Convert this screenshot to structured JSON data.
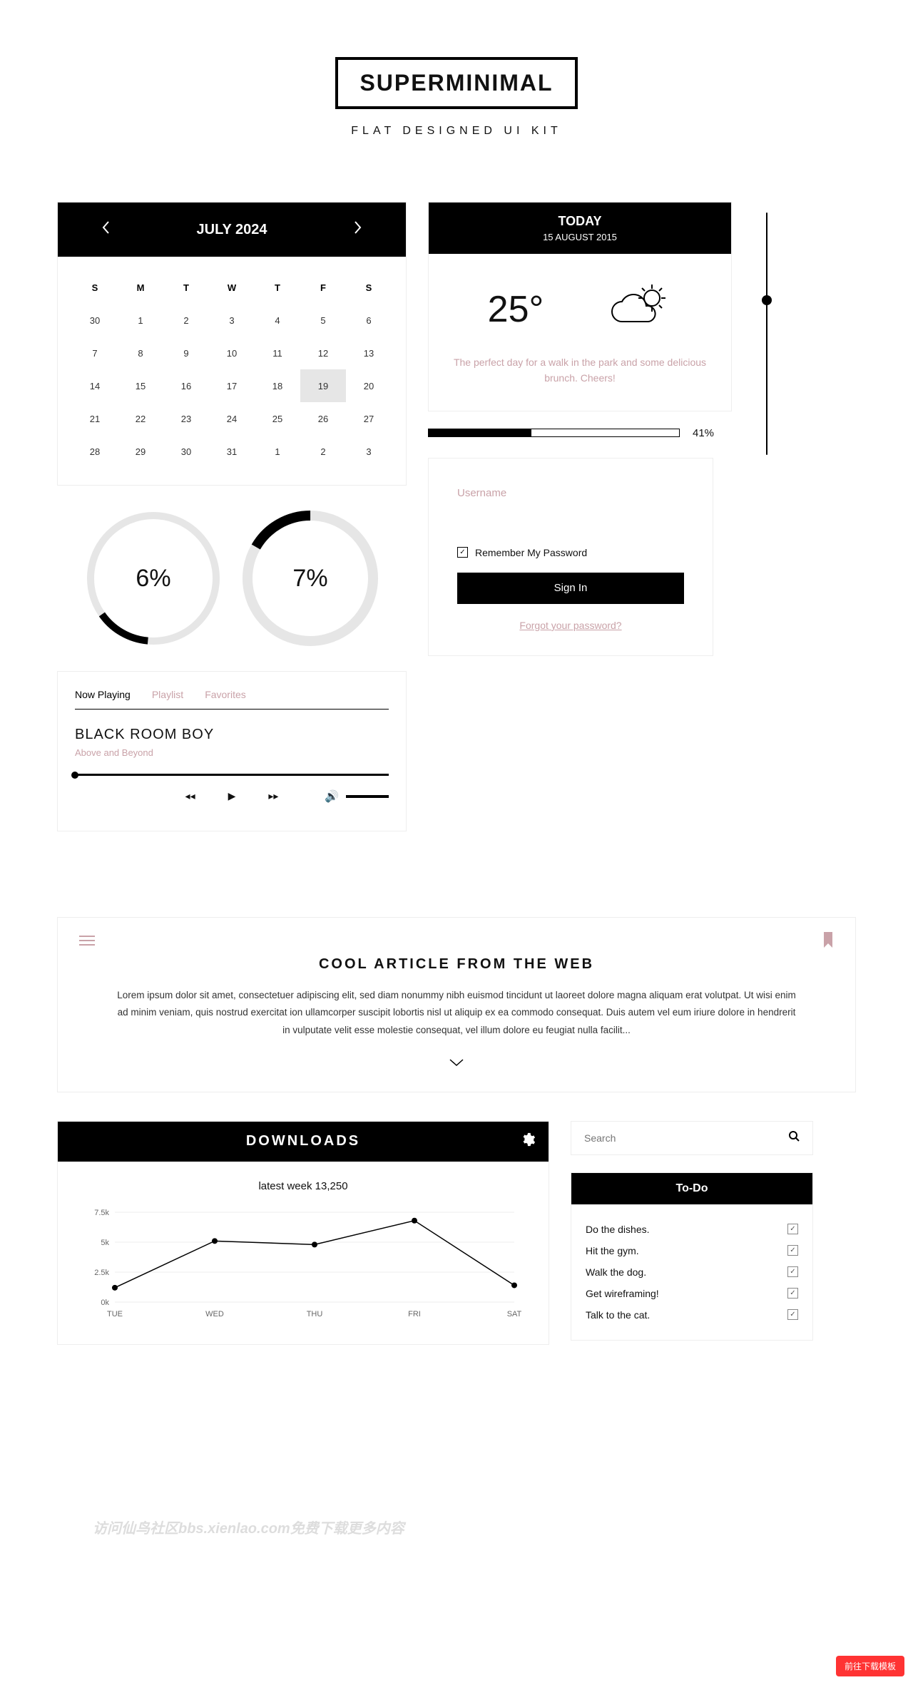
{
  "header": {
    "title": "SUPERMINIMAL",
    "subtitle": "FLAT DESIGNED UI KIT"
  },
  "calendar": {
    "month_label": "JULY 2024",
    "dow": [
      "S",
      "M",
      "T",
      "W",
      "T",
      "F",
      "S"
    ],
    "weeks": [
      [
        "30",
        "1",
        "2",
        "3",
        "4",
        "5",
        "6"
      ],
      [
        "7",
        "8",
        "9",
        "10",
        "11",
        "12",
        "13"
      ],
      [
        "14",
        "15",
        "16",
        "17",
        "18",
        "19",
        "20"
      ],
      [
        "21",
        "22",
        "23",
        "24",
        "25",
        "26",
        "27"
      ],
      [
        "28",
        "29",
        "30",
        "31",
        "1",
        "2",
        "3"
      ]
    ],
    "selected": "19"
  },
  "weather": {
    "today_label": "TODAY",
    "date": "15 AUGUST 2015",
    "temp": "25°",
    "text": "The perfect day for a walk in the park and some delicious brunch. Cheers!"
  },
  "progress": {
    "percent": 41,
    "label": "41%"
  },
  "vslider": {
    "percent": 66
  },
  "gauges": [
    {
      "percent": 6,
      "label": "6%",
      "stroke": 10,
      "gap_deg": 310,
      "rotate": 95
    },
    {
      "percent": 7,
      "label": "7%",
      "stroke": 14,
      "gap_deg": 300,
      "rotate": 210
    }
  ],
  "login": {
    "username_placeholder": "Username",
    "remember_label": "Remember My Password",
    "signin_label": "Sign In",
    "forgot_label": "Forgot your password?"
  },
  "player": {
    "tabs": [
      "Now Playing",
      "Playlist",
      "Favorites"
    ],
    "active_tab": 0,
    "track_title": "BLACK ROOM BOY",
    "track_artist": "Above and Beyond"
  },
  "article": {
    "title": "COOL ARTICLE FROM THE WEB",
    "body": "Lorem ipsum dolor sit amet, consectetuer adipiscing elit, sed diam nonummy nibh euismod tincidunt ut laoreet dolore magna aliquam erat volutpat. Ut wisi enim ad minim veniam, quis nostrud exercitat ion ullamcorper suscipit lobortis nisl ut aliquip ex ea commodo consequat. Duis autem vel eum iriure dolore in hendrerit in vulputate velit esse molestie consequat, vel illum dolore eu feugiat nulla facilit..."
  },
  "downloads": {
    "title": "DOWNLOADS",
    "caption": "latest week 13,250"
  },
  "chart_data": {
    "type": "line",
    "title": "latest week 13,250",
    "categories": [
      "TUE",
      "WED",
      "THU",
      "FRI",
      "SAT"
    ],
    "values": [
      1200,
      5100,
      4800,
      6800,
      1400
    ],
    "ylabel": "",
    "xlabel": "",
    "ylim": [
      0,
      7500
    ],
    "yticks": [
      "0k",
      "2.5k",
      "5k",
      "7.5k"
    ]
  },
  "search": {
    "placeholder": "Search"
  },
  "todo": {
    "title": "To-Do",
    "items": [
      {
        "text": "Do the dishes.",
        "checked": true
      },
      {
        "text": "Hit the gym.",
        "checked": true
      },
      {
        "text": "Walk the dog.",
        "checked": true
      },
      {
        "text": "Get wireframing!",
        "checked": true
      },
      {
        "text": "Talk to the cat.",
        "checked": true
      }
    ]
  },
  "float_btn": "前往下载模板",
  "watermark": "访问仙鸟社区bbs.xienlao.com免费下载更多内容"
}
